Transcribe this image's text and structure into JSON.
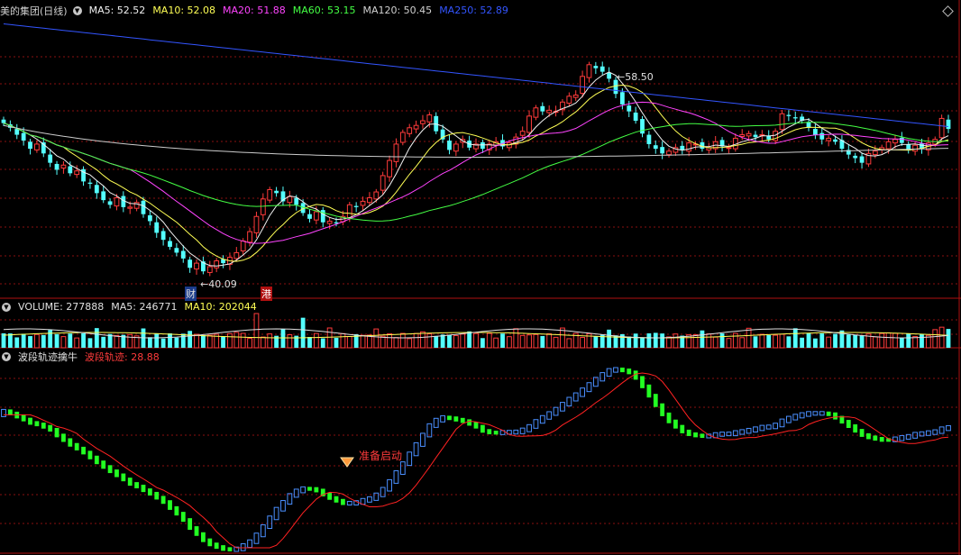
{
  "main_header": {
    "title": "美的集团(日线)",
    "ma5": "MA5: 52.52",
    "ma10": "MA10: 52.08",
    "ma20": "MA20: 51.88",
    "ma60": "MA60: 53.15",
    "ma120": "MA120: 50.45",
    "ma250": "MA250: 52.89"
  },
  "volume_header": {
    "title": "VOLUME: 277888",
    "ma5": "MA5: 246771",
    "ma10": "MA10: 202044"
  },
  "wave_header": {
    "title": "波段轨迹擒牛",
    "value": "波段轨迹: 28.88"
  },
  "annotations": {
    "high": "58.50",
    "low": "40.09",
    "marker_cai": "财",
    "marker_gang": "港",
    "signal": "准备启动"
  },
  "colors": {
    "up": "#ff3b3b",
    "down": "#54ffff",
    "ma5": "#f0f0f0",
    "ma10": "#ffff55",
    "ma20": "#ff44ff",
    "ma60": "#44ff44",
    "ma120": "#cccccc",
    "ma250": "#3355ff",
    "wave_up": "#4a8fff",
    "wave_down": "#22ff22",
    "wave_line": "#ff2222"
  },
  "chart_data": [
    {
      "type": "candlestick",
      "title": "美的集团(日线)",
      "close_series": [
        53.0,
        52.6,
        52.0,
        51.5,
        50.8,
        51.2,
        50.4,
        49.6,
        49.0,
        49.4,
        48.7,
        48.9,
        48.0,
        47.8,
        47.0,
        46.4,
        46.0,
        46.6,
        45.8,
        45.8,
        46.2,
        45.2,
        44.6,
        43.6,
        43.0,
        42.4,
        41.9,
        41.4,
        40.6,
        41.0,
        40.3,
        40.7,
        41.2,
        41.0,
        41.5,
        41.9,
        42.9,
        43.7,
        45.0,
        46.5,
        47.3,
        47.0,
        46.3,
        46.7,
        46.0,
        45.3,
        44.8,
        45.4,
        44.5,
        44.6,
        44.4,
        45.0,
        46.0,
        45.8,
        46.3,
        46.6,
        47.1,
        48.5,
        49.8,
        51.2,
        52.2,
        52.6,
        52.8,
        53.2,
        53.7,
        52.3,
        51.6,
        50.7,
        51.2,
        51.6,
        50.9,
        51.2,
        50.8,
        51.2,
        51.4,
        51.0,
        51.3,
        51.8,
        52.3,
        53.6,
        54.3,
        54.0,
        54.1,
        54.0,
        54.8,
        55.3,
        55.4,
        57.0,
        58.0,
        57.7,
        57.4,
        56.8,
        55.5,
        54.6,
        54.0,
        53.2,
        52.1,
        51.2,
        50.8,
        50.4,
        50.6,
        50.9,
        50.7,
        51.3,
        51.2,
        50.8,
        50.9,
        51.4,
        51.0,
        50.9,
        51.7,
        52.0,
        52.1,
        51.8,
        52.0,
        51.6,
        52.3,
        53.8,
        53.6,
        53.4,
        53.2,
        52.6,
        52.0,
        51.6,
        51.7,
        51.4,
        50.8,
        50.3,
        50.0,
        49.6,
        50.4,
        50.6,
        50.9,
        51.4,
        51.6,
        51.3,
        50.7,
        51.1,
        50.8,
        51.3,
        51.6,
        53.4,
        52.5
      ],
      "ma_values": {
        "MA5": 52.52,
        "MA10": 52.08,
        "MA20": 51.88,
        "MA60": 53.15,
        "MA120": 50.45,
        "MA250": 52.89
      },
      "high_marker": 58.5,
      "low_marker": 40.09,
      "ylim": [
        39,
        62
      ]
    },
    {
      "type": "bar",
      "title": "VOLUME",
      "latest": 277888,
      "ma5": 246771,
      "ma10": 202044
    },
    {
      "type": "step-line",
      "title": "波段轨迹擒牛",
      "latest": 28.88,
      "signal_label": "准备启动"
    }
  ]
}
